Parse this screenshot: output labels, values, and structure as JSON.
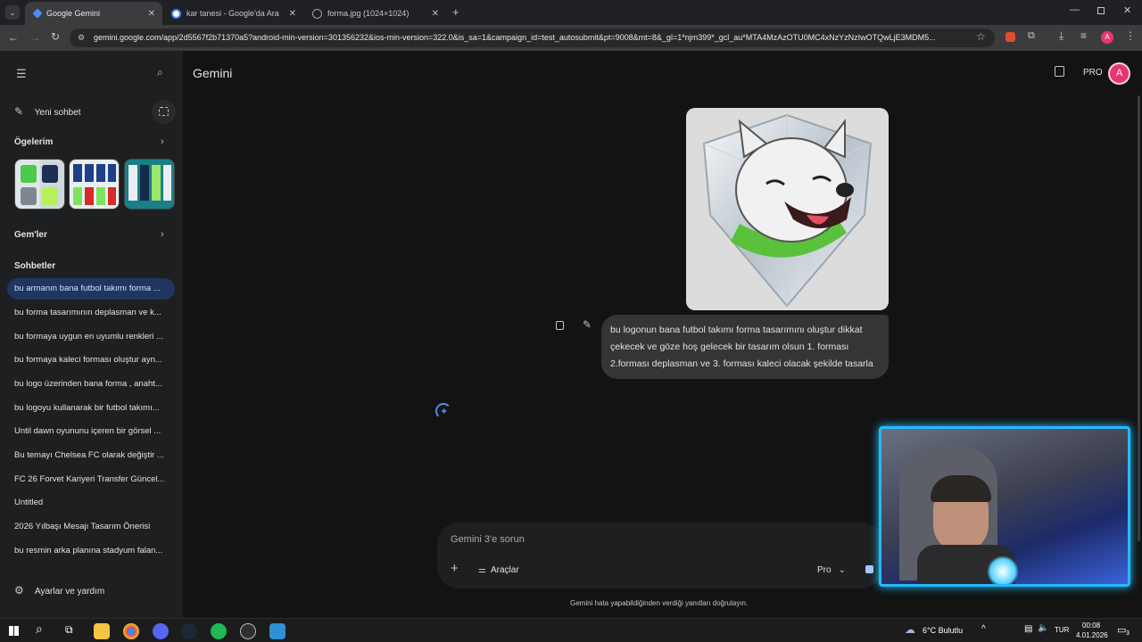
{
  "browser": {
    "tabs": [
      {
        "title": "Google Gemini",
        "active": true
      },
      {
        "title": "kar tanesi - Google'da Ara",
        "active": false
      },
      {
        "title": "forma.jpg (1024×1024)",
        "active": false
      }
    ],
    "url": "gemini.google.com/app/2d5567f2b71370a5?android-min-version=301356232&ios-min-version=322.0&is_sa=1&campaign_id=test_autosubmit&pt=9008&mt=8&_gl=1*njm399*_gcl_au*MTA4MzAzOTU0MC4xNzYzNzIwOTQwLjE3MDM5..."
  },
  "sidebar": {
    "new_chat": "Yeni sohbet",
    "items_header": "Ögelerim",
    "gems_header": "Gem'ler",
    "chats_header": "Sohbetler",
    "chats": [
      "bu armanın bana futbol takımı forma ...",
      "bu forma tasarımının deplasman ve k...",
      "bu formaya uygun en uyumlu renkleri ...",
      "bu formaya kaleci forması oluştur ayn...",
      "bu logo üzerinden bana forma , anaht...",
      "bu logoyu kullanarak bir futbol takımı...",
      "Until dawn oyununu içeren bir görsel ...",
      "Bu temayı Chelsea FC olarak değiştir ...",
      "FC 26 Forvet Kariyeri Transfer Güncel...",
      "Untitled",
      "2026 Yılbaşı Mesajı Tasarım Önerisi",
      "bu resmin arka planına stadyum falan..."
    ],
    "settings": "Ayarlar ve yardım"
  },
  "header": {
    "title": "Gemini",
    "pro_badge": "PRO",
    "avatar_letter": "A"
  },
  "conversation": {
    "user_prompt": "bu logonun bana futbol takımı forma tasarımını oluştur dikkat çekecek ve göze hoş gelecek bir tasarım olsun 1. forması 2.forması deplasman ve 3. forması kaleci olacak şekilde tasarla"
  },
  "composer": {
    "placeholder": "Gemini 3'e sorun",
    "tools_label": "Araçlar",
    "model_label": "Pro",
    "disclaimer": "Gemini hata yapabildiğinden verdiği yanıtları doğrulayın."
  },
  "taskbar": {
    "weather": "6°C  Bulutlu",
    "lang": "TUR",
    "time": "00:08",
    "date": "4.01.2026",
    "notif_count": "3"
  },
  "colors": {
    "accent": "#1f3760",
    "page_bg": "#131314",
    "sidebar_bg": "#1e1f20",
    "avatar": "#e8356d"
  }
}
